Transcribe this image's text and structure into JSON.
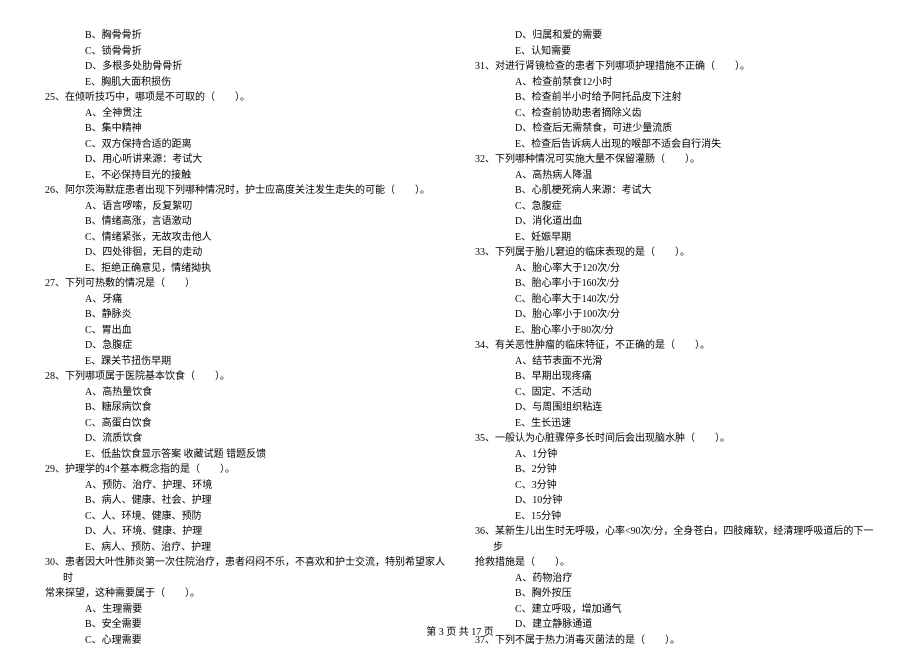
{
  "left_column": {
    "orphan_options_1": [
      "B、胸骨骨折",
      "C、锁骨骨折",
      "D、多根多处肋骨骨折",
      "E、胸肌大面积损伤"
    ],
    "q25": {
      "stem": "25、在倾听技巧中，哪项是不可取的（　　）。",
      "options": [
        "A、全神贯注",
        "B、集中精神",
        "C、双方保持合适的距离",
        "D、用心听讲来源：考试大",
        "E、不必保持目光的接触"
      ]
    },
    "q26": {
      "stem": "26、阿尔茨海默症患者出现下列哪种情况时，护士应高度关注发生走失的可能（　　）。",
      "options": [
        "A、语言啰嗦，反复絮叨",
        "B、情绪高涨，言语激动",
        "C、情绪紧张，无故攻击他人",
        "D、四处徘徊，无目的走动",
        "E、拒绝正确意见，情绪拗执"
      ]
    },
    "q27": {
      "stem": "27、下列可热敷的情况是（　　）",
      "options": [
        "A、牙痛",
        "B、静脉炎",
        "C、胃出血",
        "D、急腹症",
        "E、踝关节扭伤早期"
      ]
    },
    "q28": {
      "stem": "28、下列哪项属于医院基本饮食（　　）。",
      "options": [
        "A、高热量饮食",
        "B、糖尿病饮食",
        "C、高蛋白饮食",
        "D、流质饮食",
        "E、低盐饮食显示答案 收藏试题 错题反馈"
      ]
    },
    "q29": {
      "stem": "29、护理学的4个基本概念指的是（　　）。",
      "options": [
        "A、预防、治疗、护理、环境",
        "B、病人、健康、社会、护理",
        "C、人、环境、健康、预防",
        "D、人、环境、健康、护理",
        "E、病人、预防、治疗、护理"
      ]
    },
    "q30": {
      "stem": "30、患者因大叶性肺炎第一次住院治疗，患者闷闷不乐，不喜欢和护士交流，特别希望家人时",
      "stem_cont": "常来探望，这种需要属于（　　）。",
      "options": [
        "A、生理需要",
        "B、安全需要",
        "C、心理需要"
      ]
    }
  },
  "right_column": {
    "orphan_options_2": [
      "D、归属和爱的需要",
      "E、认知需要"
    ],
    "q31": {
      "stem": "31、对进行肾镜检查的患者下列哪项护理措施不正确（　　）。",
      "options": [
        "A、检查前禁食12小时",
        "B、检查前半小时给予阿托品皮下注射",
        "C、检查前协助患者摘除义齿",
        "D、检查后无需禁食，可进少量流质",
        "E、检查后告诉病人出现的喉部不适会自行消失"
      ]
    },
    "q32": {
      "stem": "32、下列哪种情况可实施大量不保留灌肠（　　）。",
      "options": [
        "A、高热病人降温",
        "B、心肌梗死病人来源：考试大",
        "C、急腹症",
        "D、消化道出血",
        "E、妊娠早期"
      ]
    },
    "q33": {
      "stem": "33、下列属于胎儿窘迫的临床表现的是（　　）。",
      "options": [
        "A、胎心率大于120次/分",
        "B、胎心率小于160次/分",
        "C、胎心率大于140次/分",
        "D、胎心率小于100次/分",
        "E、胎心率小于80次/分"
      ]
    },
    "q34": {
      "stem": "34、有关恶性肿瘤的临床特征，不正确的是（　　）。",
      "options": [
        "A、结节表面不光滑",
        "B、早期出现疼痛",
        "C、固定、不活动",
        "D、与周围组织粘连",
        "E、生长迅速"
      ]
    },
    "q35": {
      "stem": "35、一般认为心脏骤停多长时间后会出现脑水肿（　　）。",
      "options": [
        "A、1分钟",
        "B、2分钟",
        "C、3分钟",
        "D、10分钟",
        "E、15分钟"
      ]
    },
    "q36": {
      "stem": "36、某新生儿出生时无呼吸，心率<90次/分，全身苍白，四肢瘫软，经清理呼吸道后的下一步",
      "stem_cont": "抢救措施是（　　）。",
      "options": [
        "A、药物治疗",
        "B、胸外按压",
        "C、建立呼吸，增加通气",
        "D、建立静脉通道"
      ]
    },
    "q37": {
      "stem": "37、下列不属于热力消毒灭菌法的是（　　）。"
    }
  },
  "footer": "第 3 页 共 17 页"
}
